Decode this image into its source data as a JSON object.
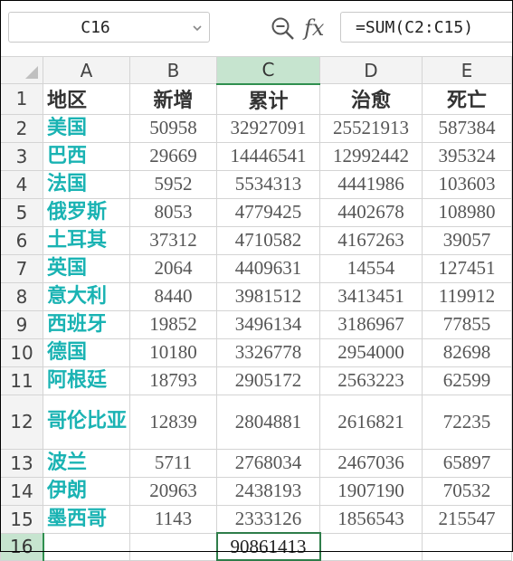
{
  "formula_bar": {
    "name_box": "C16",
    "formula": "=SUM(C2:C15)",
    "zoom_icon": "zoom-out-magnifier-icon",
    "fx_label": "fx"
  },
  "columns": [
    "A",
    "B",
    "C",
    "D",
    "E"
  ],
  "selected_column": "C",
  "selected_row": "16",
  "header_row": {
    "row_number": "1",
    "cells": [
      "地区",
      "新增",
      "累计",
      "治愈",
      "死亡"
    ]
  },
  "rows": [
    {
      "row_number": "2",
      "region": "美国",
      "new": "50958",
      "total": "32927091",
      "cured": "25521913",
      "deaths": "587384"
    },
    {
      "row_number": "3",
      "region": "巴西",
      "new": "29669",
      "total": "14446541",
      "cured": "12992442",
      "deaths": "395324"
    },
    {
      "row_number": "4",
      "region": "法国",
      "new": "5952",
      "total": "5534313",
      "cured": "4441986",
      "deaths": "103603"
    },
    {
      "row_number": "5",
      "region": "俄罗斯",
      "new": "8053",
      "total": "4779425",
      "cured": "4402678",
      "deaths": "108980"
    },
    {
      "row_number": "6",
      "region": "土耳其",
      "new": "37312",
      "total": "4710582",
      "cured": "4167263",
      "deaths": "39057"
    },
    {
      "row_number": "7",
      "region": "英国",
      "new": "2064",
      "total": "4409631",
      "cured": "14554",
      "deaths": "127451"
    },
    {
      "row_number": "8",
      "region": "意大利",
      "new": "8440",
      "total": "3981512",
      "cured": "3413451",
      "deaths": "119912"
    },
    {
      "row_number": "9",
      "region": "西班牙",
      "new": "19852",
      "total": "3496134",
      "cured": "3186967",
      "deaths": "77855"
    },
    {
      "row_number": "10",
      "region": "德国",
      "new": "10180",
      "total": "3326778",
      "cured": "2954000",
      "deaths": "82698"
    },
    {
      "row_number": "11",
      "region": "阿根廷",
      "new": "18793",
      "total": "2905172",
      "cured": "2563223",
      "deaths": "62599"
    },
    {
      "row_number": "12",
      "region": "哥伦比亚",
      "new": "12839",
      "total": "2804881",
      "cured": "2616821",
      "deaths": "72235"
    },
    {
      "row_number": "13",
      "region": "波兰",
      "new": "5711",
      "total": "2768034",
      "cured": "2467036",
      "deaths": "65897"
    },
    {
      "row_number": "14",
      "region": "伊朗",
      "new": "20963",
      "total": "2438193",
      "cured": "1907190",
      "deaths": "70532"
    },
    {
      "row_number": "15",
      "region": "墨西哥",
      "new": "1143",
      "total": "2333126",
      "cured": "1856543",
      "deaths": "215547"
    }
  ],
  "sum_row": {
    "row_number": "16",
    "total_sum": "90861413"
  },
  "colors": {
    "region_text": "#1ab3b3",
    "selection_green": "#2f7d4a",
    "selected_header_bg": "#c6e4cf"
  }
}
